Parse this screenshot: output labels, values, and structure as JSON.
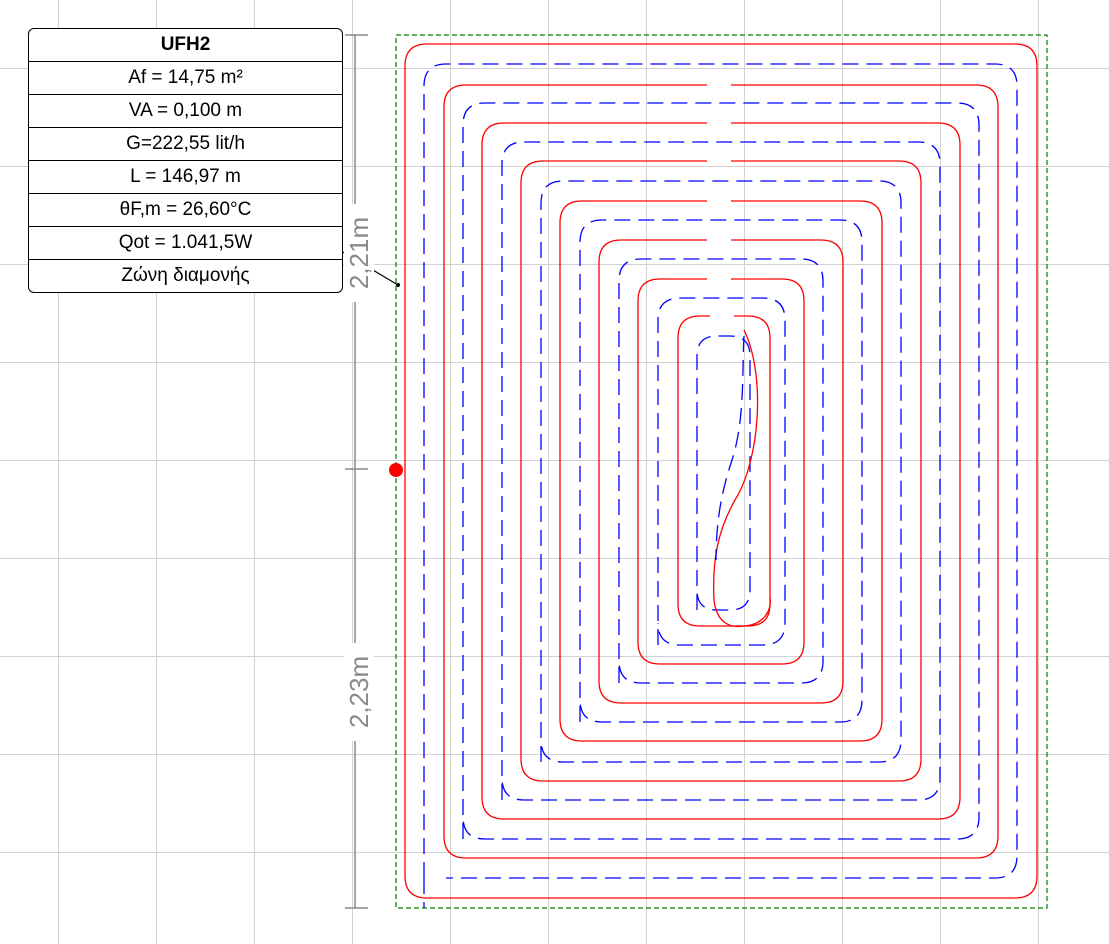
{
  "circuit": {
    "name": "UFH2",
    "area": "Af = 14,75 m²",
    "spacing": "VA = 0,100 m",
    "flow": "G=222,55 lit/h",
    "length": "L = 146,97 m",
    "temperature": "θF,m = 26,60°C",
    "heat_output": "Qot = 1.041,5W",
    "zone": "Ζώνη διαμονής"
  },
  "dimensions": {
    "upper": "2,21m",
    "lower": "2,23m"
  },
  "colors": {
    "supply_pipe": "#ff0000",
    "return_pipe": "#0000ff",
    "boundary": "#008000",
    "dimension_line": "#8a8a8a",
    "manifold_connection": "#ff0000",
    "grid": "#d2d2d2"
  },
  "pipe_loops": 8
}
